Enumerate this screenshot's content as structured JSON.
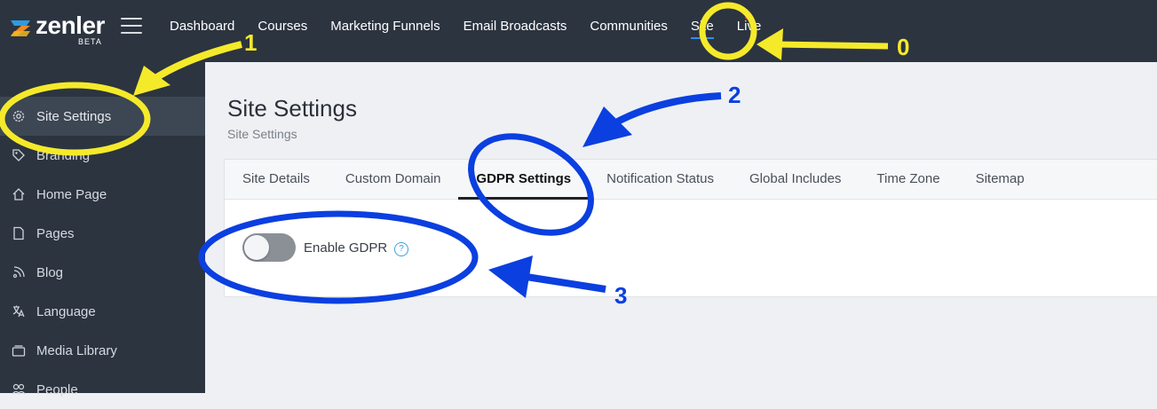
{
  "app": {
    "logo_text": "zenler",
    "logo_badge": "BETA"
  },
  "nav": {
    "items": [
      {
        "label": "Dashboard"
      },
      {
        "label": "Courses"
      },
      {
        "label": "Marketing Funnels"
      },
      {
        "label": "Email Broadcasts"
      },
      {
        "label": "Communities"
      },
      {
        "label": "Site",
        "active": true
      },
      {
        "label": "Live"
      }
    ]
  },
  "sidebar": {
    "items": [
      {
        "label": "Site Settings",
        "icon": "gear-icon",
        "active": true
      },
      {
        "label": "Branding",
        "icon": "tag-icon"
      },
      {
        "label": "Home Page",
        "icon": "home-icon"
      },
      {
        "label": "Pages",
        "icon": "page-icon"
      },
      {
        "label": "Blog",
        "icon": "rss-icon"
      },
      {
        "label": "Language",
        "icon": "translate-icon"
      },
      {
        "label": "Media Library",
        "icon": "media-icon"
      },
      {
        "label": "People",
        "icon": "people-icon"
      }
    ]
  },
  "main": {
    "title": "Site Settings",
    "breadcrumb": "Site Settings",
    "tabs": [
      {
        "label": "Site Details"
      },
      {
        "label": "Custom Domain"
      },
      {
        "label": "GDPR Settings",
        "active": true
      },
      {
        "label": "Notification Status"
      },
      {
        "label": "Global Includes"
      },
      {
        "label": "Time Zone"
      },
      {
        "label": "Sitemap"
      }
    ],
    "gdpr": {
      "label": "Enable GDPR",
      "enabled": false,
      "help": "?"
    }
  },
  "annotations": {
    "labels": [
      "0",
      "1",
      "2",
      "3"
    ],
    "colors": {
      "yellow": "#f5ea2a",
      "blue": "#0b3fe0"
    }
  },
  "colors": {
    "topbar": "#2c3440",
    "accent": "#2f8ef2",
    "background": "#eef0f4"
  }
}
